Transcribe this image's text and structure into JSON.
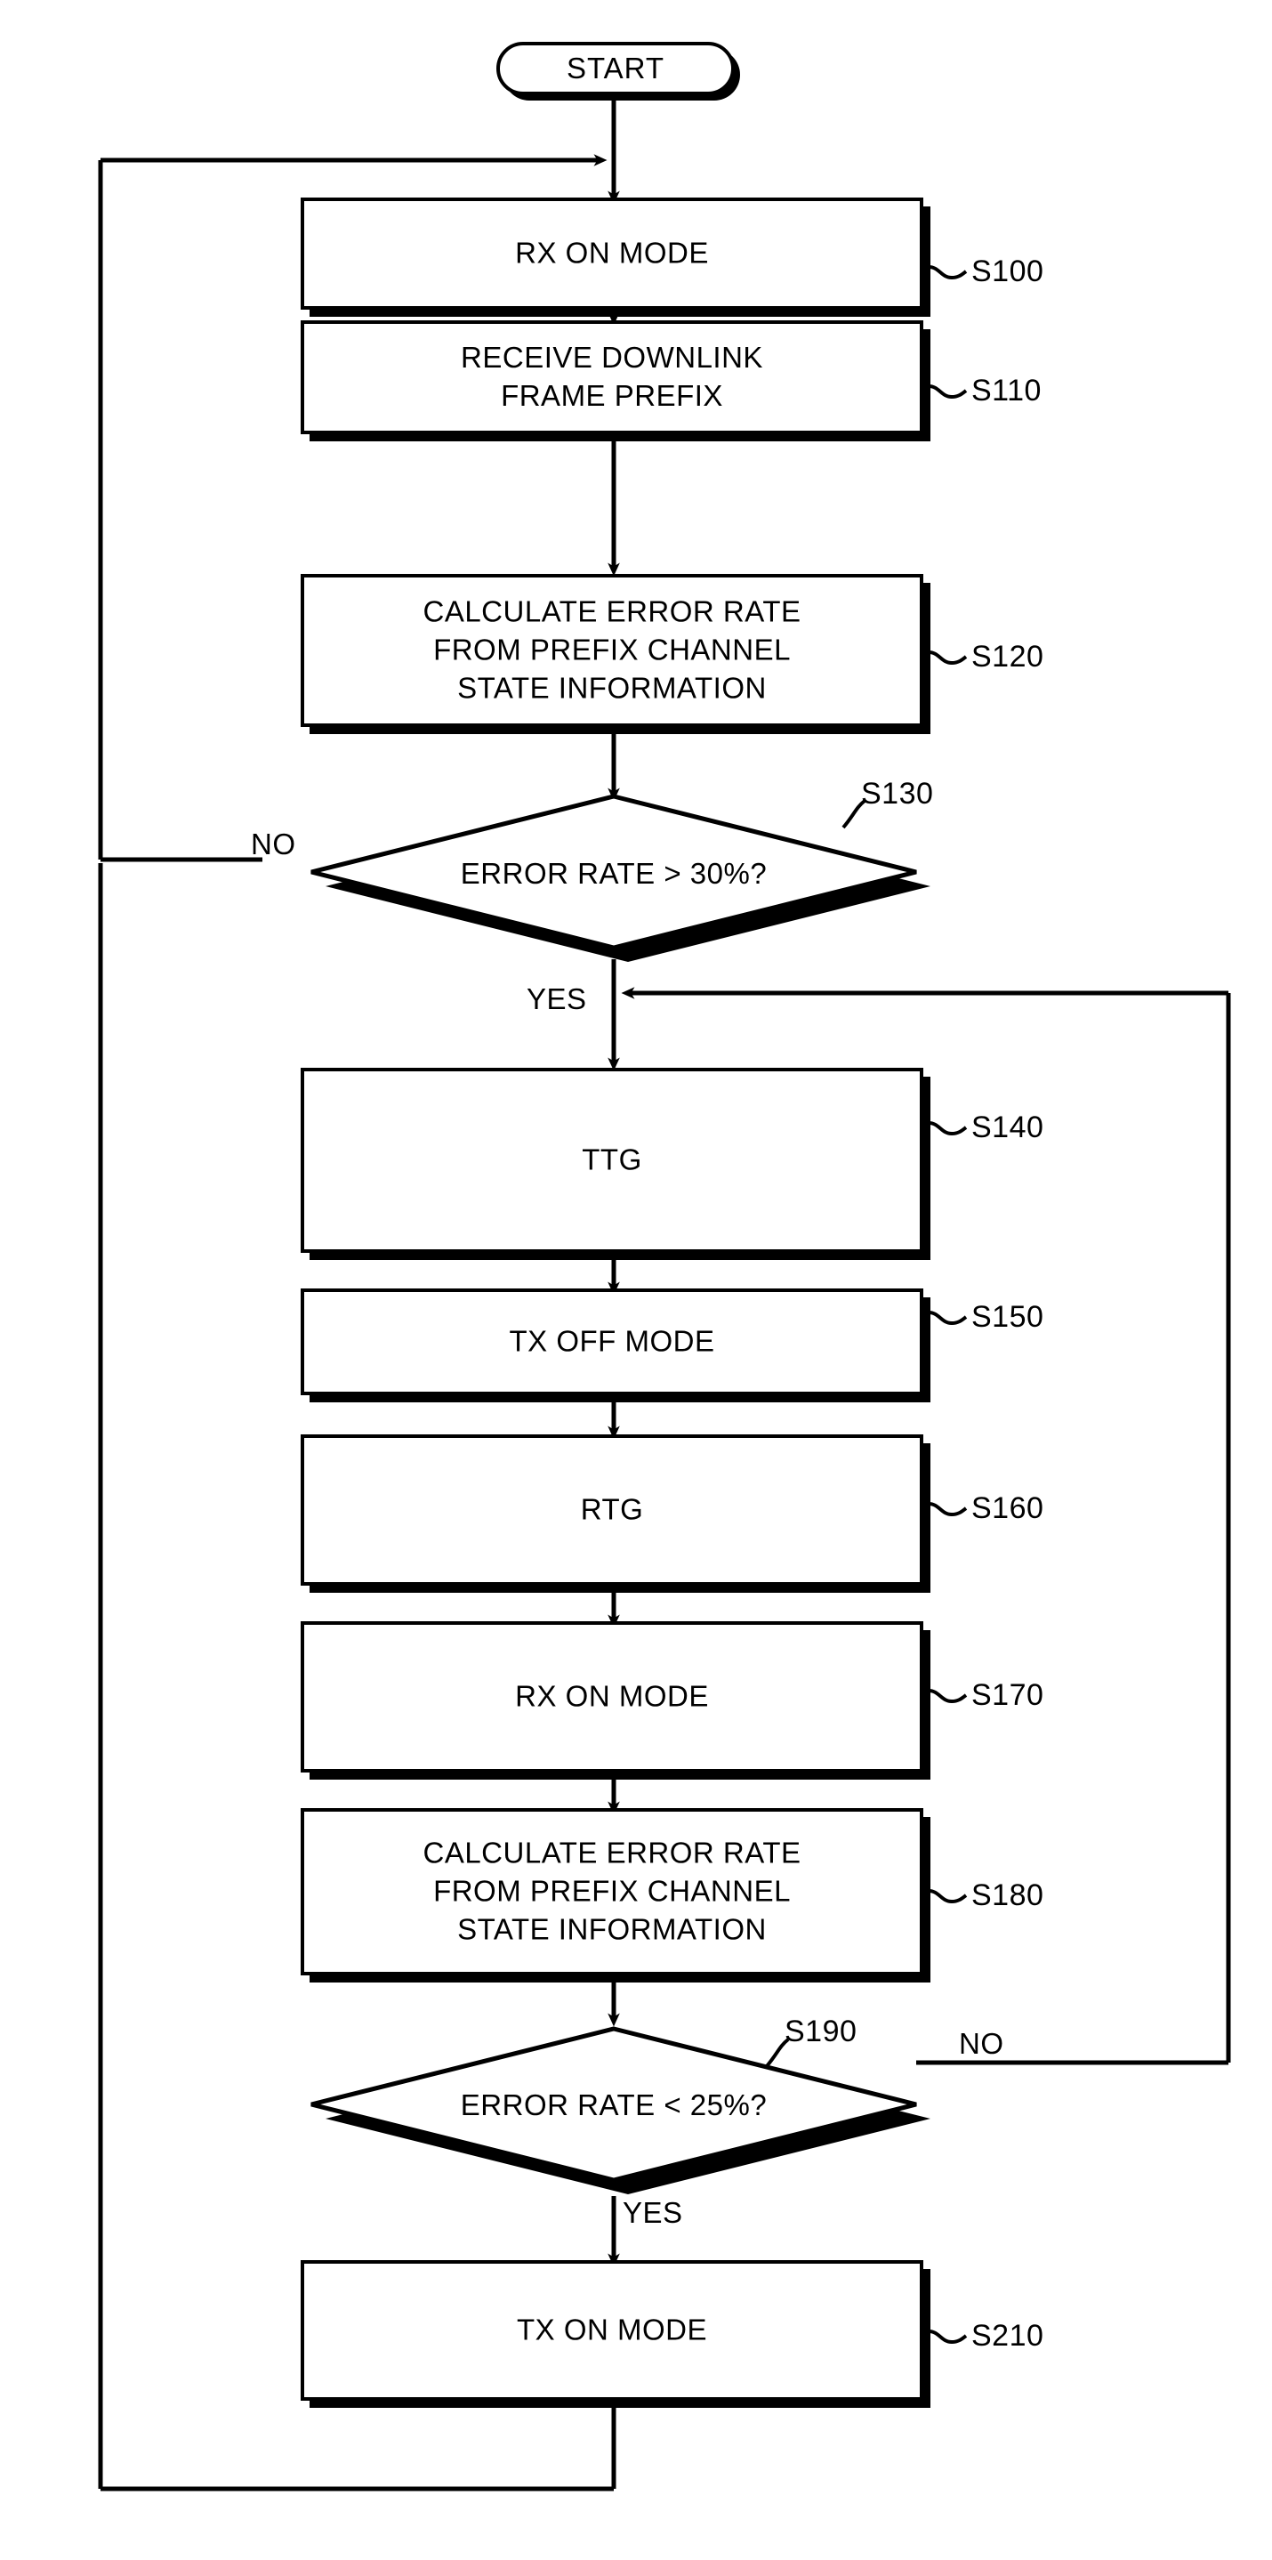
{
  "figure": {
    "type": "flowchart",
    "orientation": "vertical",
    "background_color": "#ffffff",
    "line_color": "#000000"
  },
  "nodes": {
    "start": {
      "label": "START",
      "shape": "terminator"
    },
    "s100": {
      "label": "RX ON MODE",
      "shape": "process",
      "ref": "S100"
    },
    "s110": {
      "label": "RECEIVE DOWNLINK\nFRAME PREFIX",
      "shape": "process",
      "ref": "S110"
    },
    "s120": {
      "label": "CALCULATE ERROR RATE\nFROM PREFIX CHANNEL\nSTATE INFORMATION",
      "shape": "process",
      "ref": "S120"
    },
    "s130": {
      "label": "ERROR RATE > 30%?",
      "shape": "decision",
      "ref": "S130"
    },
    "s140": {
      "label": "TTG",
      "shape": "process",
      "ref": "S140"
    },
    "s150": {
      "label": "TX OFF MODE",
      "shape": "process",
      "ref": "S150"
    },
    "s160": {
      "label": "RTG",
      "shape": "process",
      "ref": "S160"
    },
    "s170": {
      "label": "RX ON MODE",
      "shape": "process",
      "ref": "S170"
    },
    "s180": {
      "label": "CALCULATE ERROR RATE\nFROM PREFIX CHANNEL\nSTATE INFORMATION",
      "shape": "process",
      "ref": "S180"
    },
    "s190": {
      "label": "ERROR RATE < 25%?",
      "shape": "decision",
      "ref": "S190"
    },
    "s210": {
      "label": "TX ON MODE",
      "shape": "process",
      "ref": "S210"
    }
  },
  "edge_labels": {
    "s130_no": "NO",
    "s130_yes": "YES",
    "s190_no": "NO",
    "s190_yes": "YES"
  },
  "edges": [
    {
      "from": "start",
      "to": "s100",
      "label": ""
    },
    {
      "from": "s100",
      "to": "s110",
      "label": ""
    },
    {
      "from": "s110",
      "to": "s120",
      "label": ""
    },
    {
      "from": "s120",
      "to": "s130",
      "label": ""
    },
    {
      "from": "s130",
      "to": "s100",
      "label": "NO"
    },
    {
      "from": "s130",
      "to": "s140",
      "label": "YES"
    },
    {
      "from": "s140",
      "to": "s150",
      "label": ""
    },
    {
      "from": "s150",
      "to": "s160",
      "label": ""
    },
    {
      "from": "s160",
      "to": "s170",
      "label": ""
    },
    {
      "from": "s170",
      "to": "s180",
      "label": ""
    },
    {
      "from": "s180",
      "to": "s190",
      "label": ""
    },
    {
      "from": "s190",
      "to": "s140",
      "label": "NO"
    },
    {
      "from": "s190",
      "to": "s210",
      "label": "YES"
    },
    {
      "from": "s210",
      "to": "s100",
      "label": ""
    }
  ]
}
